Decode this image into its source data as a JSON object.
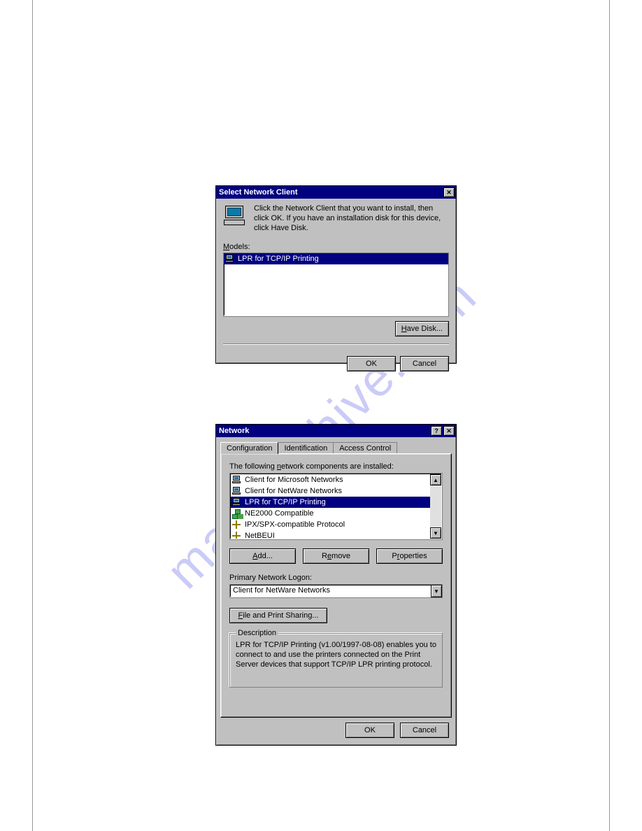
{
  "watermark": "manualshive.com",
  "dialog1": {
    "title": "Select Network Client",
    "instruction": "Click the Network Client that you want to install, then click OK. If you have an installation disk for this device, click Have Disk.",
    "models_label": "Models:",
    "items": [
      {
        "label": "LPR for TCP/IP Printing",
        "selected": true
      }
    ],
    "have_disk": "Have Disk...",
    "ok": "OK",
    "cancel": "Cancel"
  },
  "dialog2": {
    "title": "Network",
    "tabs": [
      {
        "label": "Configuration",
        "active": true
      },
      {
        "label": "Identification",
        "active": false
      },
      {
        "label": "Access Control",
        "active": false
      }
    ],
    "components_label": "The following network components are installed:",
    "components": [
      {
        "icon": "client",
        "label": "Client for Microsoft Networks",
        "selected": false
      },
      {
        "icon": "client",
        "label": "Client for NetWare Networks",
        "selected": false
      },
      {
        "icon": "client",
        "label": "LPR for TCP/IP Printing",
        "selected": true
      },
      {
        "icon": "adapter",
        "label": "NE2000 Compatible",
        "selected": false
      },
      {
        "icon": "protocol",
        "label": "IPX/SPX-compatible Protocol",
        "selected": false
      },
      {
        "icon": "protocol",
        "label": "NetBEUI",
        "selected": false
      }
    ],
    "add": "Add...",
    "remove": "Remove",
    "properties": "Properties",
    "primary_logon_label": "Primary Network Logon:",
    "primary_logon_value": "Client for NetWare Networks",
    "file_print_sharing": "File and Print Sharing...",
    "description_legend": "Description",
    "description_text": "LPR for TCP/IP Printing (v1.00/1997-08-08) enables you to connect to and use the printers connected on the Print Server devices that support TCP/IP LPR printing protocol.",
    "ok": "OK",
    "cancel": "Cancel"
  }
}
